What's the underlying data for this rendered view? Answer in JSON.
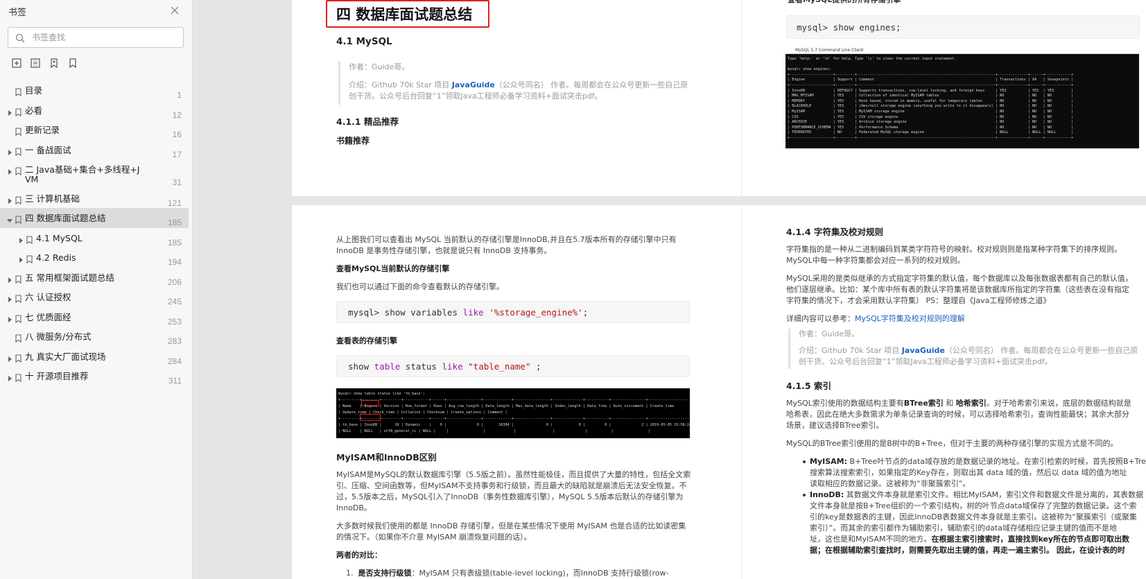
{
  "sidebar": {
    "title": "书签",
    "search_placeholder": "书签查找",
    "toc": [
      {
        "label": "目录",
        "page": "1",
        "caret": false,
        "indent": 0
      },
      {
        "label": "必看",
        "page": "12",
        "caret": true,
        "indent": 0
      },
      {
        "label": "更新记录",
        "page": "16",
        "caret": false,
        "indent": 0
      },
      {
        "label": "一 备战面试",
        "page": "17",
        "caret": true,
        "indent": 0
      },
      {
        "label": "二 Java基础+集合+多线程+J",
        "label2": "VM",
        "page": "31",
        "caret": true,
        "indent": 0
      },
      {
        "label": "三 计算机基础",
        "page": "121",
        "caret": true,
        "indent": 0
      },
      {
        "label": "四 数据库面试题总结",
        "page": "185",
        "caret": true,
        "indent": 0,
        "active": true
      },
      {
        "label": "4.1 MySQL",
        "page": "185",
        "caret": true,
        "indent": 1
      },
      {
        "label": "4.2 Redis",
        "page": "194",
        "caret": true,
        "indent": 1
      },
      {
        "label": "五 常用框架面试题总结",
        "page": "206",
        "caret": true,
        "indent": 0
      },
      {
        "label": "六 认证授权",
        "page": "245",
        "caret": true,
        "indent": 0
      },
      {
        "label": "七 优质面经",
        "page": "253",
        "caret": true,
        "indent": 0
      },
      {
        "label": "八 微服务/分布式",
        "page": "283",
        "caret": false,
        "indent": 0
      },
      {
        "label": "九 真实大厂面试现场",
        "page": "284",
        "caret": true,
        "indent": 0
      },
      {
        "label": "十 开源项目推荐",
        "page": "311",
        "caret": true,
        "indent": 0
      }
    ]
  },
  "pages": {
    "p1": {
      "heading": "四 数据库面试题总结",
      "mysql": "4.1 MySQL",
      "author": "作者：Guide哥。",
      "intro_a": "介绍：Github 70k Star 项目 ",
      "intro_link": "JavaGuide",
      "intro_b": "（公众号同名） 作者。每周都会在公众号更新一些自己原",
      "intro_c": "创干货。公众号后台回复“1”领取Java工程师必备学习资料+面试突击pdf。",
      "s411": "4.1.1 精品推荐",
      "books": "书籍推荐"
    },
    "p2": {
      "top_cut": "查看MySQL提供的所有存储引擎",
      "code": "mysql> show engines;",
      "term_title": "MySQL 5.7 Command Line Client",
      "term_lines": [
        "Type 'help;' or '\\h' for help. Type '\\c' to clear the current input statement.",
        "",
        "mysql> show engines;",
        "+--------------------+---------+----------------------------------------------------------------+--------------+------+------------+",
        "| Engine             | Support | Comment                                                        | Transactions | XA   | Savepoints |",
        "+--------------------+---------+----------------------------------------------------------------+--------------+------+------------+",
        "| InnoDB             | DEFAULT | Supports transactions, row-level locking, and foreign keys     | YES          | YES  | YES        |",
        "| MRG_MYISAM         | YES     | Collection of identical MyISAM tables                          | NO           | NO   | NO         |",
        "| MEMORY             | YES     | Hash based, stored in memory, useful for temporary tables      | NO           | NO   | NO         |",
        "| BLACKHOLE          | YES     | /dev/null storage engine (anything you write to it disappears) | NO           | NO   | NO         |",
        "| MyISAM             | YES     | MyISAM storage engine                                          | NO           | NO   | NO         |",
        "| CSV                | YES     | CSV storage engine                                             | NO           | NO   | NO         |",
        "| ARCHIVE            | YES     | Archive storage engine                                         | NO           | NO   | NO         |",
        "| PERFORMANCE_SCHEMA | YES     | Performance Schema                                             | NO           | NO   | NO         |",
        "| FEDERATED          | NO      | Federated MySQL storage engine                                 | NULL         | NULL | NULL       |",
        "+--------------------+---------+----------------------------------------------------------------+--------------+------+------------+"
      ]
    },
    "p3": {
      "l1": "从上图我们可以查看出 MySQL 当前默认的存储引擎是InnoDB,并且在5.7版本所有的存储引擎中只有",
      "l2": "InnoDB 是事务性存储引擎，也就是说只有 InnoDB 支持事务。",
      "l3": "查看MySQL当前默认的存储引擎",
      "l4": "我们也可以通过下面的命令查看默认的存储引擎。",
      "code1_a": "mysql> show variables ",
      "code1_kw": "like",
      "code1_str": "'%storage_engine%'",
      "code1_end": ";",
      "l5": "查看表的存储引擎",
      "code2_a": "show ",
      "code2_kw1": "table",
      "code2_b": " status ",
      "code2_kw2": "like",
      "code2_str": "\"table_name\"",
      "code2_end": " ;",
      "term2_lines": [
        "mysql> show table status like 'tb_base';",
        "+---------+--------+---------+------------+------+----------------+-------------+-----------------+--------------+-----------+----------------+---------------------+",
        "| Name    | Engine | Version | Row_format | Rows | Avg_row_length | Data_length | Max_data_length | Index_length | Data_free | Auto_increment | Create_time         |",
        "| Update_time | Check_time | Collation | Checksum | Create_options | Comment |",
        "+---------+--------+---------+------------+------+----------------+-------------+-----------------+--------------+-----------+----------------+---------------------+",
        "| tb_base | InnoDB |      10 | Dynamic    |    0 |              0 |       16384 |               0 |            0 |         0 |              2 | 2019-05-05 15:58:24 |",
        "| NULL    | NULL   | utf8_general_ci | NULL |     |                |             |                 |              |           |                |                     |"
      ],
      "h_myisam": "MyISAM和InnoDB区别",
      "m1": "MyISAM是MySQL的默认数据库引擎（5.5版之前）。虽然性能极佳，而且提供了大量的特性，包括全文索",
      "m2": "引、压缩、空间函数等，但MyISAM不支持事务和行级锁，而且最大的缺陷就是崩溃后无法安全恢复。不",
      "m3": "过，5.5版本之后，MySQL引入了InnoDB（事务性数据库引擎），MySQL 5.5版本后默认的存储引擎为",
      "m4": "InnoDB。",
      "n1": "大多数时候我们使用的都是 InnoDB 存储引擎，但是在某些情况下使用 MyISAM 也是合适的比如读密集",
      "n2": "的情况下。（如果你不介意 MyISAM 崩溃恢复问题的话）。",
      "cmp": "两者的对比：",
      "item1_num": "1.",
      "item1_b": "是否支持行级锁",
      "item1_rest": "：MyISAM 只有表级锁(table-level locking)，而InnoDB 支持行级锁(row-"
    },
    "p4": {
      "h414": "4.1.4 字符集及校对规则",
      "c1": "字符集指的是一种从二进制编码到某类字符符号的映射。校对规则则是指某种字符集下的排序规则。",
      "c2": "MySQL中每一种字符集都会对应一系列的校对规则。",
      "c3": "MySQL采用的是类似继承的方式指定字符集的默认值，每个数据库以及每张数据表都有自己的默认值，",
      "c4": "他们逐层继承。比如：某个库中所有表的默认字符集将是该数据库所指定的字符集（这些表在没有指定",
      "c5": "字符集的情况下，才会采用默认字符集） PS：整理自《Java工程师修炼之道》",
      "detail_a": "详细内容可以参考：",
      "detail_link": "MySQL字符集及校对规则的理解",
      "author": "作者：Guide哥。",
      "intro_a": "介绍：Github 70k Star 项目 ",
      "intro_link": "JavaGuide",
      "intro_b": "（公众号同名） 作者。每周都会在公众号更新一些自己原",
      "intro_c": "创干货。公众号后台回复“1”领取Java工程师必备学习资料+面试突击pdf。",
      "h415": "4.1.5 索引",
      "i1_a": "MySQL索引使用的数据结构主要有",
      "i1_b1": "BTree索引",
      "i1_mid": " 和 ",
      "i1_b2": "哈希索引",
      "i1_c": "。对于哈希索引来说，底层的数据结构就是",
      "i2": "哈希表，因此在绝大多数需求为单条记录查询的时候，可以选择哈希索引，查询性能最快；其余大部分",
      "i3": "场景，建议选择BTree索引。",
      "i4": "MySQL的BTree索引使用的是B树中的B+Tree，但对于主要的两种存储引擎的实现方式是不同的。",
      "b1_label": "MyISAM:",
      "b1_l1": " B+Tree叶节点的data域存放的是数据记录的地址。在索引检索的时候，首先按照B+Tree",
      "b1_l2": "搜索算法搜索索引，如果指定的Key存在，则取出其 data 域的值，然后以 data 域的值为地址",
      "b1_l3": "读取相应的数据记录。这被称为“非聚簇索引”。",
      "b2_label": "InnoDB:",
      "b2_l1": " 其数据文件本身就是索引文件。相比MyISAM，索引文件和数据文件是分离的，其表数据",
      "b2_l2": "文件本身就是按B+Tree组织的一个索引结构，树的叶节点data域保存了完整的数据记录。这个索",
      "b2_l3": "引的key是数据表的主键，因此InnoDB表数据文件本身就是主索引。这被称为“聚簇索引（或聚集",
      "b2_l4": "索引）”。而其余的索引都作为辅助索引，辅助索引的data域存储相应记录主键的值而不是地",
      "b2_l5a": "址，这也是和MyISAM不同的地方。",
      "b2_l5b": "在根据主索引搜索时，直接找到key所在的节点即可取出数",
      "b2_l6": "据；在根据辅助索引查找时，则需要先取出主键的值，再走一遍主索引。 因此，在设计表的时"
    }
  }
}
